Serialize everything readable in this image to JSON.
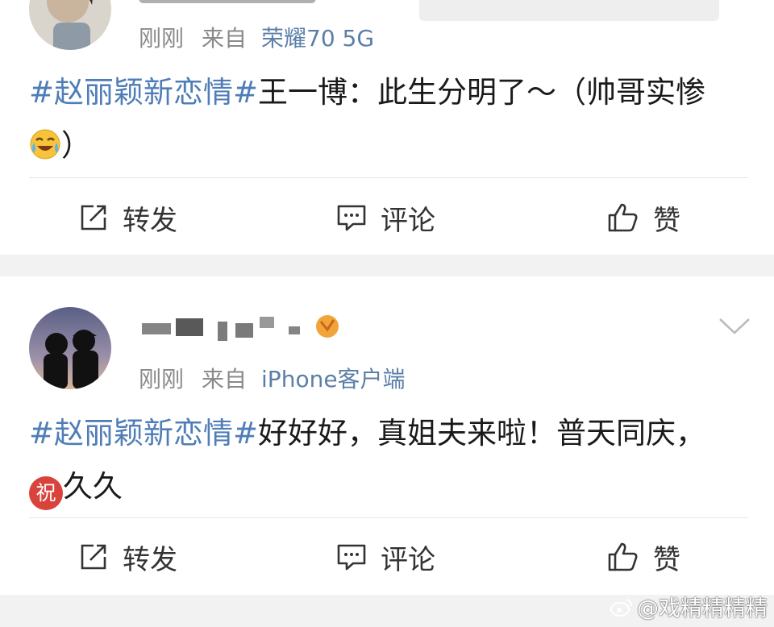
{
  "colors": {
    "accent": "#4f7db7",
    "meta": "#8a8a8a",
    "background": "#f2f2f2"
  },
  "posts": [
    {
      "time": "刚刚",
      "from_label": "来自",
      "source": "荣耀70 5G",
      "hashtag": "#赵丽颖新恋情#",
      "text_line1": "王一博：此生分明了～（帅哥实惨",
      "emoji_name": "laugh-cry-emoji",
      "text_line2_after_emoji": "）",
      "actions": {
        "repost": "转发",
        "comment": "评论",
        "like": "赞"
      }
    },
    {
      "time": "刚刚",
      "from_label": "来自",
      "source": "iPhone客户端",
      "hashtag": "#赵丽颖新恋情#",
      "text_line1": "好好好，真姐夫来啦！普天同庆，",
      "emoji_name": "blessing-emoji",
      "emoji_text": "祝",
      "text_line2_after_emoji": "久久",
      "actions": {
        "repost": "转发",
        "comment": "评论",
        "like": "赞"
      }
    }
  ],
  "watermark": "@戏精精精精"
}
